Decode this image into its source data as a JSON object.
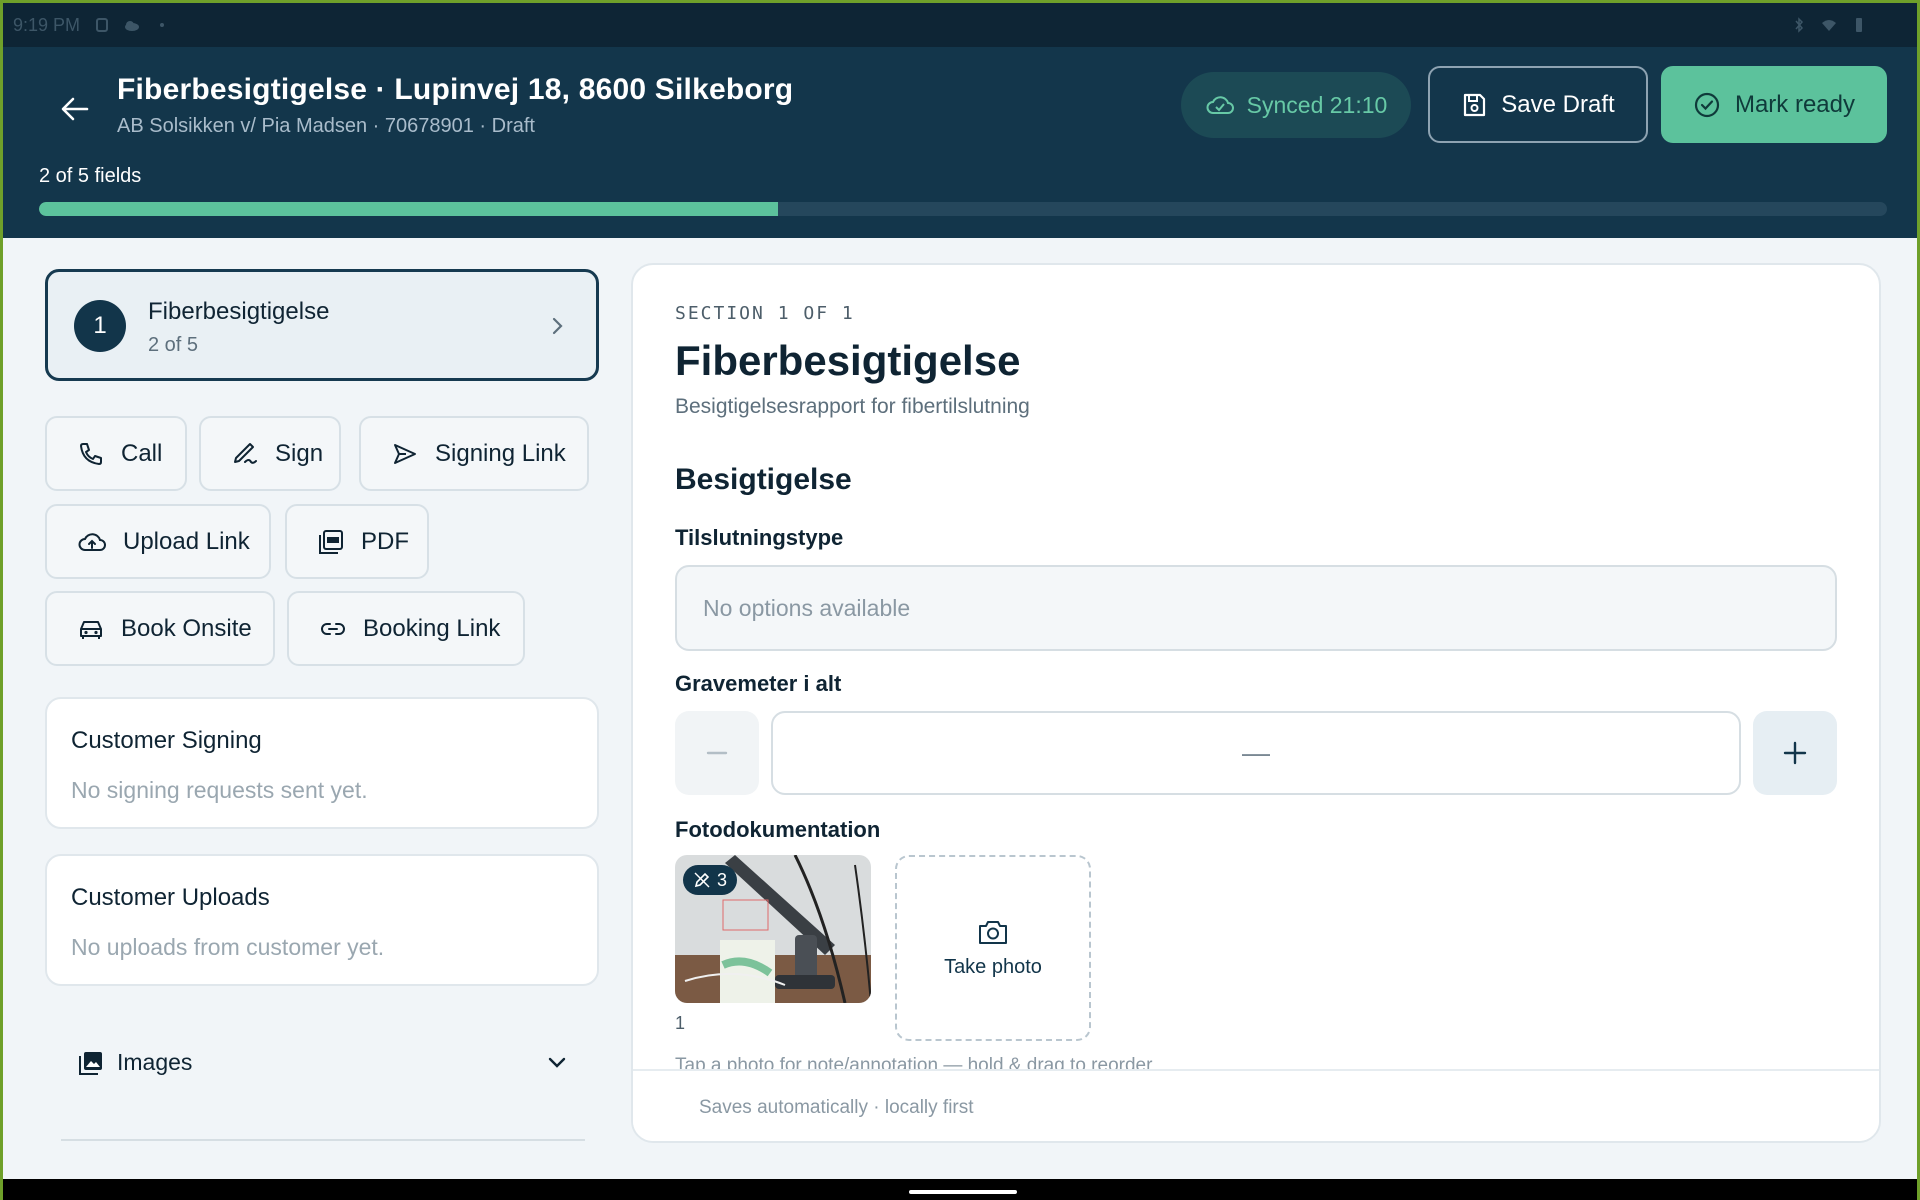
{
  "statusbar": {
    "time": "9:19 PM"
  },
  "header": {
    "title": "Fiberbesigtigelse · Lupinvej 18, 8600 Silkeborg",
    "subtitle": "AB Solsikken v/ Pia Madsen · 70678901 · Draft",
    "synced_label": "Synced 21:10",
    "save_draft_label": "Save Draft",
    "mark_ready_label": "Mark ready",
    "progress_label": "2 of 5 fields",
    "progress_fraction": 0.4,
    "accent_color": "#5cc29c",
    "header_color": "#13364b"
  },
  "sidebar": {
    "section": {
      "number": "1",
      "name": "Fiberbesigtigelse",
      "count": "2 of 5"
    },
    "actions": {
      "call": "Call",
      "sign": "Sign",
      "signing_link": "Signing Link",
      "upload_link": "Upload Link",
      "pdf": "PDF",
      "book_onsite": "Book Onsite",
      "booking_link": "Booking Link"
    },
    "customer_signing": {
      "title": "Customer Signing",
      "text": "No signing requests sent yet."
    },
    "customer_uploads": {
      "title": "Customer Uploads",
      "text": "No uploads from customer yet."
    },
    "images_label": "Images"
  },
  "main": {
    "kicker": "SECTION 1 OF 1",
    "title": "Fiberbesigtigelse",
    "description": "Besigtigelsesrapport for fibertilslutning",
    "group_title": "Besigtigelse",
    "fields": {
      "connection_type": {
        "label": "Tilslutningstype",
        "placeholder": "No options available"
      },
      "dig_meters": {
        "label": "Gravemeter i alt",
        "value": "—"
      },
      "photos": {
        "label": "Fotodokumentation",
        "annotation_count": "3",
        "photo_index": "1",
        "take_photo_label": "Take photo",
        "hint": "Tap a photo for note/annotation — hold & drag to reorder"
      }
    },
    "footer_text": "Saves automatically · locally first"
  }
}
